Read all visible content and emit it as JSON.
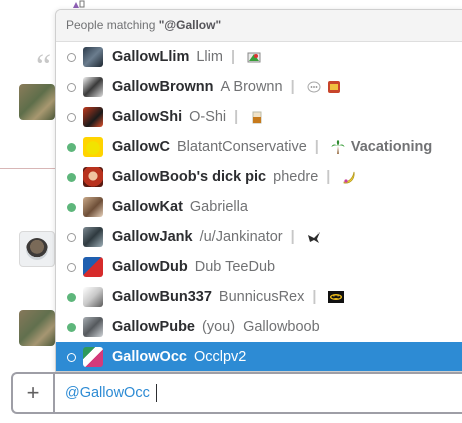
{
  "popup": {
    "header_prefix": "People matching ",
    "query": "\"@Gallow\""
  },
  "people": [
    {
      "name": "GallowLlim",
      "secondary": "Llim",
      "presence": "away",
      "status_emoji": "status-emoji-flag",
      "status_text": ""
    },
    {
      "name": "GallowBrownn",
      "secondary": "A Brownn",
      "presence": "away",
      "status_emoji": "status-emoji-speech-and-trophy",
      "status_text": ""
    },
    {
      "name": "GallowShi",
      "secondary": "O-Shi",
      "presence": "dnd",
      "status_emoji": "status-emoji-drink",
      "status_text": ""
    },
    {
      "name": "GallowC",
      "secondary": "BlatantConservative",
      "presence": "active",
      "status_emoji": "palm-tree-icon",
      "status_text": "Vacationing"
    },
    {
      "name": "GallowBoob's dick pic",
      "secondary": "phedre",
      "presence": "active",
      "status_emoji": "status-emoji-banana",
      "status_text": ""
    },
    {
      "name": "GallowKat",
      "secondary": "Gabriella",
      "presence": "active",
      "status_emoji": "",
      "status_text": ""
    },
    {
      "name": "GallowJank",
      "secondary": "/u/Jankinator",
      "presence": "away",
      "status_emoji": "status-emoji-eagle",
      "status_text": ""
    },
    {
      "name": "GallowDub",
      "secondary": "Dub TeeDub",
      "presence": "away",
      "status_emoji": "",
      "status_text": ""
    },
    {
      "name": "GallowBun337",
      "secondary": "BunnicusRex",
      "presence": "active",
      "status_emoji": "status-emoji-batman",
      "status_text": ""
    },
    {
      "name": "GallowPube",
      "secondary": "(you)  Gallowboob",
      "presence": "active",
      "status_emoji": "",
      "status_text": ""
    },
    {
      "name": "GallowOcc",
      "secondary": "Occlpv2",
      "presence": "away",
      "status_emoji": "",
      "status_text": "",
      "selected": true
    }
  ],
  "composer": {
    "plus_label": "+",
    "value": "@GallowOcc"
  },
  "colors": {
    "selected_row": "#2d8bd4",
    "active_presence": "#5eb67b",
    "mention_text": "#2d8bd4"
  }
}
